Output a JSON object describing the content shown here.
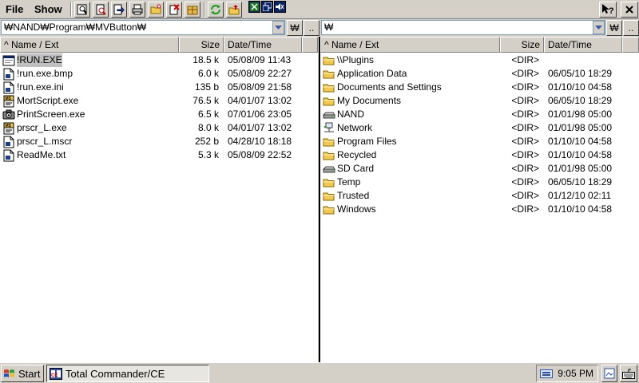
{
  "menu": {
    "file": "File",
    "show": "Show"
  },
  "colors": {
    "window": "#d4d0c8",
    "selection": "#c0c0c0",
    "folder": "#f2c94c"
  },
  "left": {
    "path": "₩NAND₩Program₩MVButton₩",
    "root_button": "₩",
    "up_button": "..",
    "columns": {
      "name": "^ Name / Ext",
      "size": "Size",
      "date": "Date/Time"
    },
    "files": [
      {
        "name": "!RUN.EXE",
        "size": "18.5 k",
        "date": "05/08/09 11:43",
        "icon": "exe-icon",
        "selected": true
      },
      {
        "name": "!run.exe.bmp",
        "size": "6.0 k",
        "date": "05/08/09 22:27",
        "icon": "file-icon"
      },
      {
        "name": "!run.exe.ini",
        "size": "135 b",
        "date": "05/08/09 21:58",
        "icon": "file-icon"
      },
      {
        "name": "MortScript.exe",
        "size": "76.5 k",
        "date": "04/01/07 13:02",
        "icon": "script-exe-icon"
      },
      {
        "name": "PrintScreen.exe",
        "size": "6.5 k",
        "date": "07/01/06 23:05",
        "icon": "camera-icon"
      },
      {
        "name": "prscr_L.exe",
        "size": "8.0 k",
        "date": "04/01/07 13:02",
        "icon": "script-exe-icon"
      },
      {
        "name": "prscr_L.mscr",
        "size": "252 b",
        "date": "04/28/10 18:18",
        "icon": "file-icon"
      },
      {
        "name": "ReadMe.txt",
        "size": "5.3 k",
        "date": "05/08/09 22:52",
        "icon": "file-icon"
      }
    ]
  },
  "right": {
    "path": "₩",
    "root_button": "₩",
    "up_button": "..",
    "columns": {
      "name": "^ Name / Ext",
      "size": "Size",
      "date": "Date/Time"
    },
    "files": [
      {
        "name": "\\\\Plugins",
        "size": "<DIR>",
        "date": "",
        "icon": "folder-icon"
      },
      {
        "name": "Application Data",
        "size": "<DIR>",
        "date": "06/05/10 18:29",
        "icon": "folder-icon"
      },
      {
        "name": "Documents and Settings",
        "size": "<DIR>",
        "date": "01/10/10 04:58",
        "icon": "folder-icon"
      },
      {
        "name": "My Documents",
        "size": "<DIR>",
        "date": "06/05/10 18:29",
        "icon": "folder-icon"
      },
      {
        "name": "NAND",
        "size": "<DIR>",
        "date": "01/01/98 05:00",
        "icon": "drive-icon"
      },
      {
        "name": "Network",
        "size": "<DIR>",
        "date": "01/01/98 05:00",
        "icon": "network-icon"
      },
      {
        "name": "Program Files",
        "size": "<DIR>",
        "date": "01/10/10 04:58",
        "icon": "folder-icon"
      },
      {
        "name": "Recycled",
        "size": "<DIR>",
        "date": "01/10/10 04:58",
        "icon": "folder-icon"
      },
      {
        "name": "SD Card",
        "size": "<DIR>",
        "date": "01/01/98 05:00",
        "icon": "drive-icon"
      },
      {
        "name": "Temp",
        "size": "<DIR>",
        "date": "06/05/10 18:29",
        "icon": "folder-icon"
      },
      {
        "name": "Trusted",
        "size": "<DIR>",
        "date": "01/12/10 02:11",
        "icon": "folder-icon"
      },
      {
        "name": "Windows",
        "size": "<DIR>",
        "date": "01/10/10 04:58",
        "icon": "folder-icon"
      }
    ]
  },
  "taskbar": {
    "start": "Start",
    "task": "Total Commander/CE",
    "clock": "9:05 PM"
  }
}
